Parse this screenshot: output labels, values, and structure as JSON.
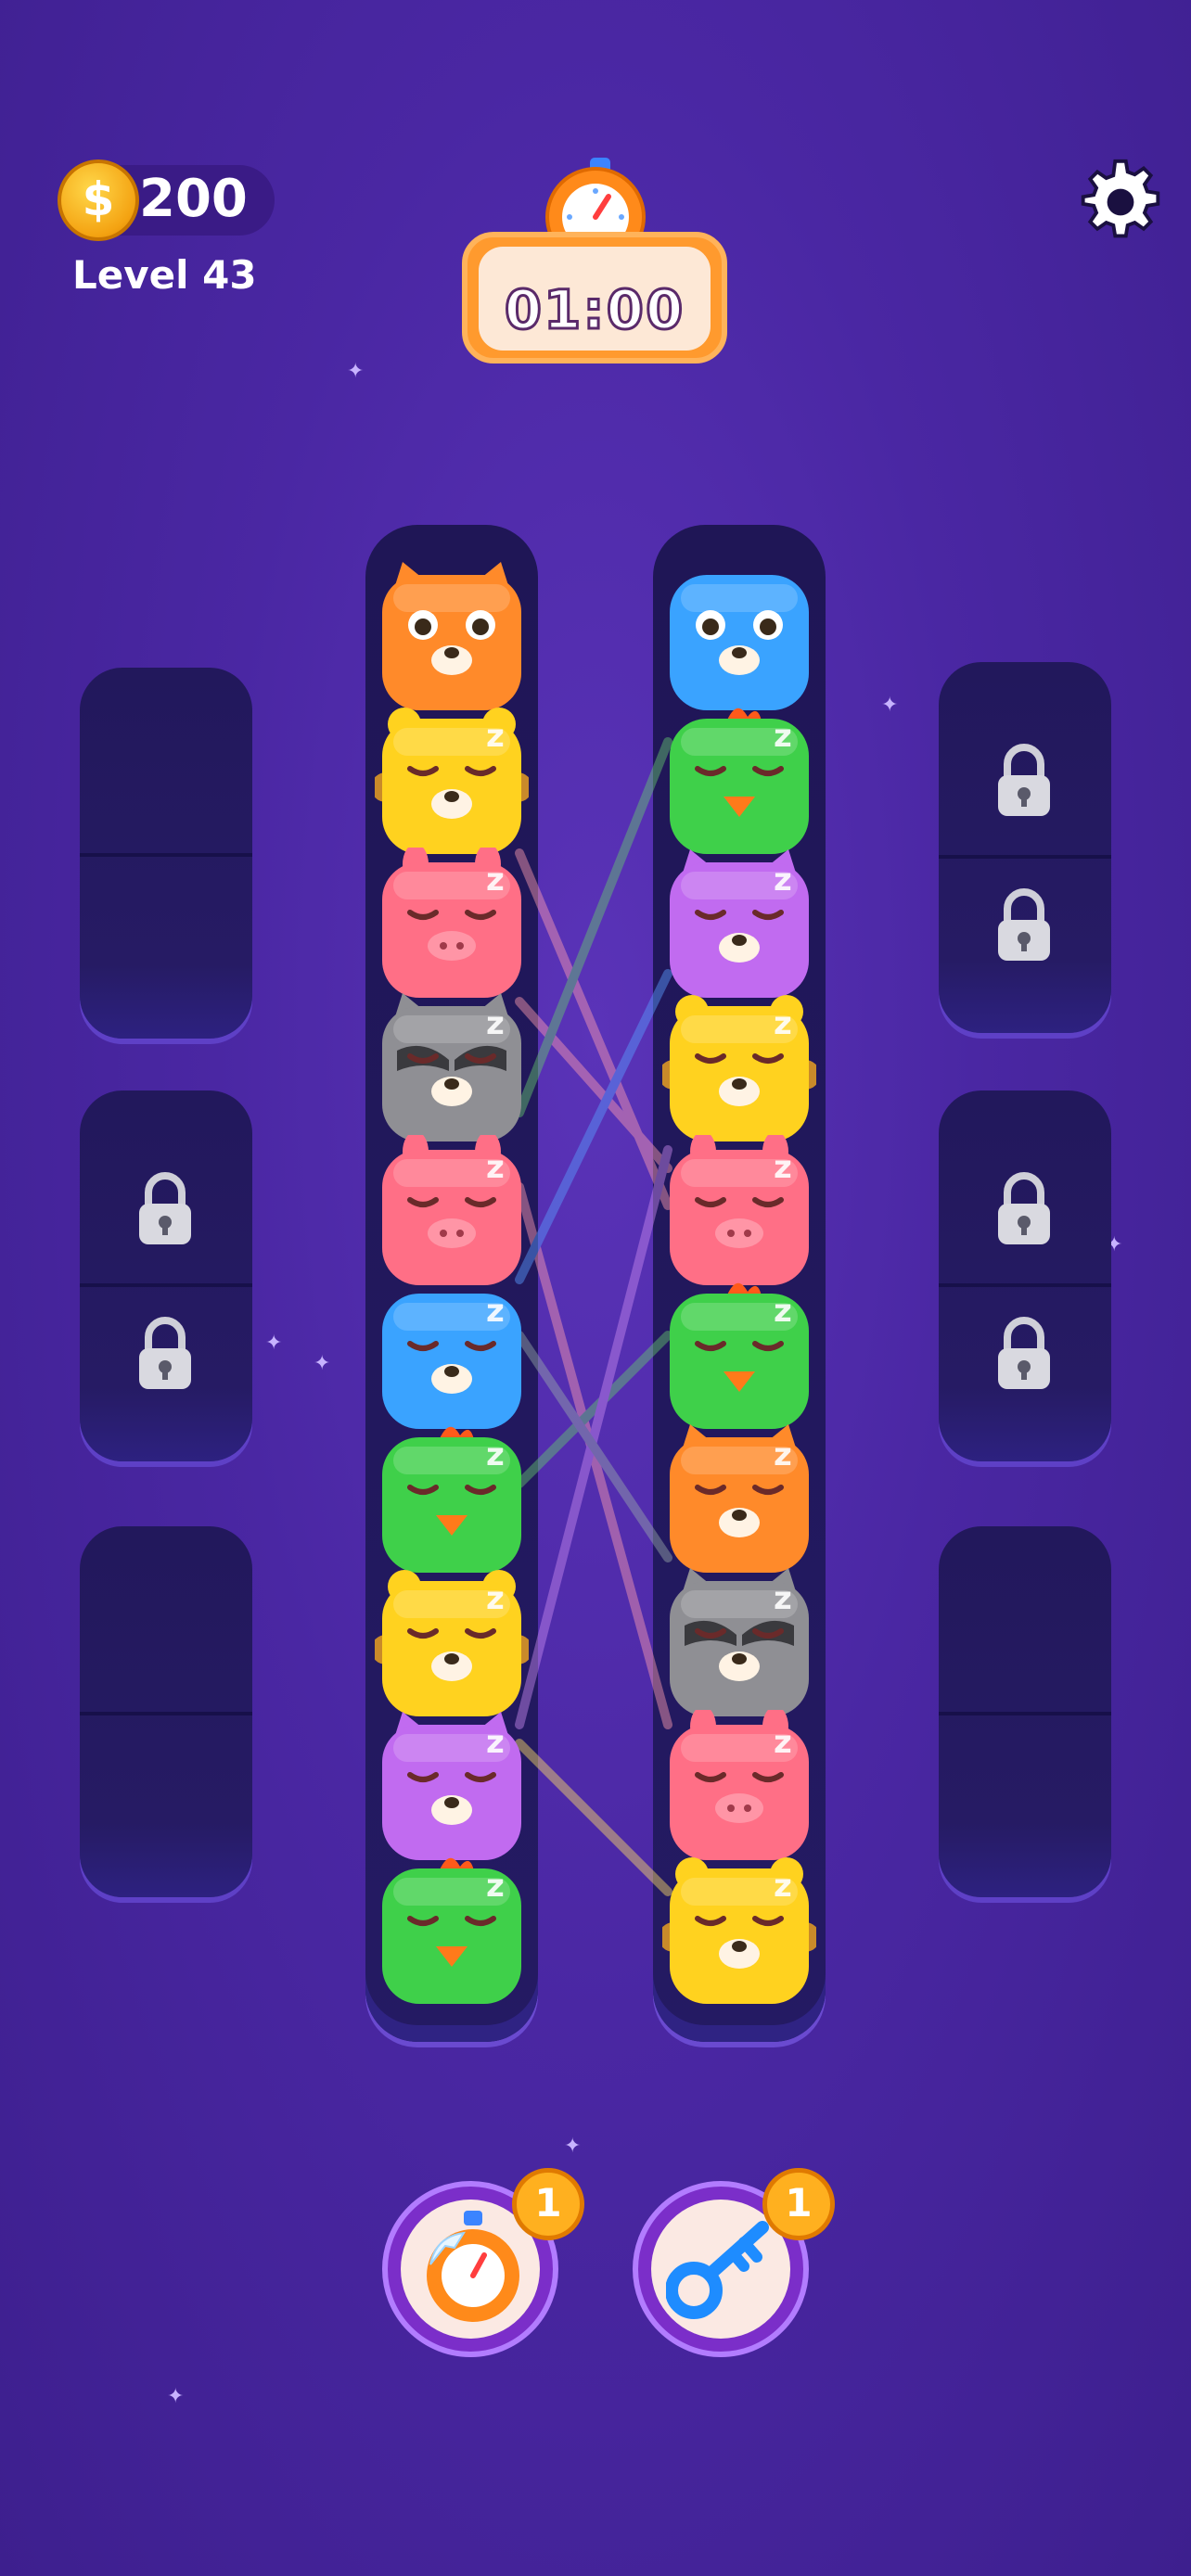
{
  "hud": {
    "coins": "200",
    "coin_symbol": "$",
    "level": "Level 43",
    "timer": "01:00"
  },
  "tubes": [
    {
      "name": "left",
      "animals": [
        "fox",
        "lion",
        "pig",
        "raccoon",
        "pig",
        "owl",
        "chicken",
        "lion",
        "cat",
        "chicken"
      ]
    },
    {
      "name": "right",
      "animals": [
        "owl",
        "chicken",
        "cat",
        "lion",
        "pig",
        "chicken",
        "fox",
        "raccoon",
        "pig",
        "lion"
      ]
    }
  ],
  "side_slots": [
    {
      "id": "left-top",
      "locked": false
    },
    {
      "id": "left-middle",
      "locked": true
    },
    {
      "id": "left-bottom",
      "locked": false
    },
    {
      "id": "right-top",
      "locked": true
    },
    {
      "id": "right-middle",
      "locked": true
    },
    {
      "id": "right-bottom",
      "locked": false
    }
  ],
  "boosters": {
    "freeze_count": "1",
    "key_count": "1"
  },
  "colors": {
    "fox": "#ff8a2a",
    "lion": "#ffd21f",
    "pig": "#ff6f86",
    "raccoon": "#8f8f94",
    "owl": "#3aa3ff",
    "chicken": "#3fd04a",
    "cat": "#c16bf0"
  }
}
